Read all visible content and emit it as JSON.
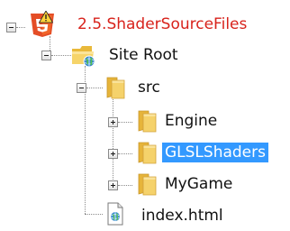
{
  "tree": {
    "project": {
      "label": "2.5.ShaderSourceFiles",
      "icon": "html5-project-warning-icon",
      "expanded": true
    },
    "site_root": {
      "label": "Site Root",
      "icon": "web-folder-icon",
      "expanded": true
    },
    "src": {
      "label": "src",
      "icon": "folder-icon",
      "expanded": true
    },
    "children": [
      {
        "label": "Engine",
        "icon": "folder-icon",
        "expanded": false,
        "selected": false
      },
      {
        "label": "GLSLShaders",
        "icon": "folder-icon",
        "expanded": false,
        "selected": true
      },
      {
        "label": "MyGame",
        "icon": "folder-icon",
        "expanded": false,
        "selected": false
      }
    ],
    "file": {
      "label": "index.html",
      "icon": "html-file-icon"
    }
  },
  "colors": {
    "project_label": "#d8231c",
    "selection_bg": "#3399ff",
    "folder": "#f2c84b",
    "html5_badge": "#e44d26"
  }
}
